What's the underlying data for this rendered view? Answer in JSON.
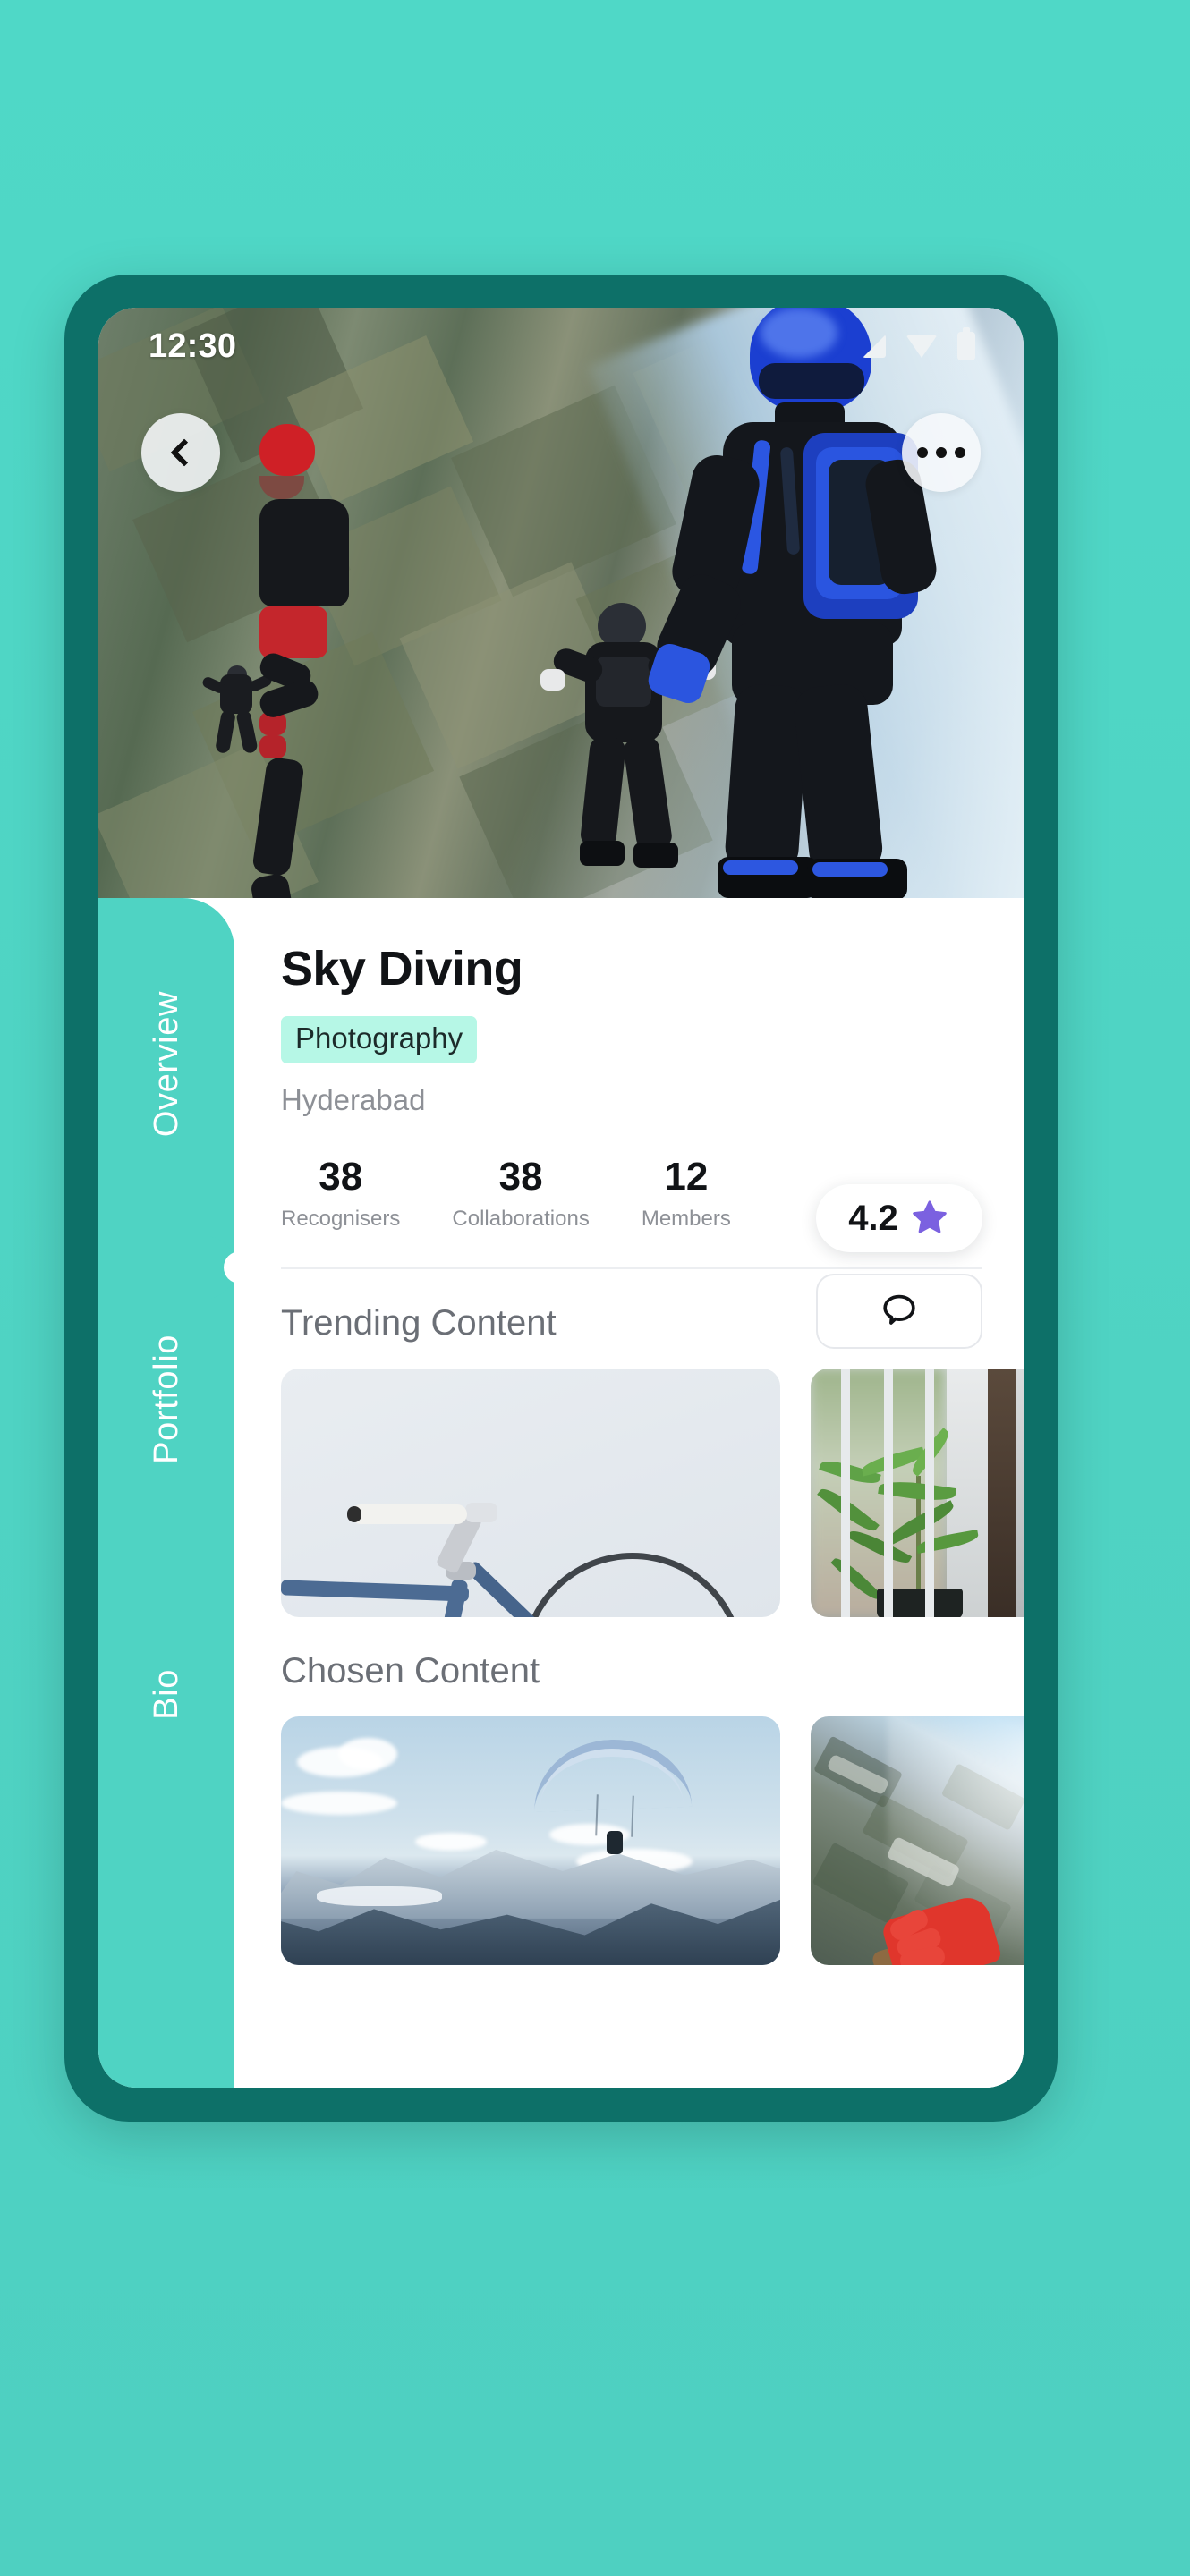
{
  "theme": {
    "page_background": "#4fd3c3",
    "device_bezel": "#0d7068",
    "rail_background": "#4fd3c3",
    "tag_background": "#b6f7e6",
    "star_color": "#7b61e0",
    "accent": "#4fd3c3"
  },
  "status_bar": {
    "time": "12:30",
    "icons": [
      "signal-icon",
      "wifi-icon",
      "battery-icon"
    ]
  },
  "hero": {
    "image_alt": "Skydivers in freefall above patchwork farmland",
    "back_icon": "chevron-left-icon",
    "more_icon": "more-horizontal-icon"
  },
  "side_rail": {
    "tabs": [
      {
        "label": "Overview",
        "active": true
      },
      {
        "label": "Portfolio",
        "active": false
      },
      {
        "label": "Bio",
        "active": false
      }
    ]
  },
  "profile": {
    "title": "Sky Diving",
    "category": "Photography",
    "location": "Hyderabad",
    "stats": [
      {
        "value": "38",
        "label": "Recognisers"
      },
      {
        "value": "38",
        "label": "Collaborations"
      },
      {
        "value": "12",
        "label": "Members"
      }
    ],
    "rating": {
      "value": "4.2",
      "icon": "star-icon"
    },
    "chat": {
      "icon": "chat-bubble-icon"
    }
  },
  "sections": [
    {
      "title": "Trending Content",
      "items": [
        {
          "alt": "White-handlebar blue road bicycle on light grey backdrop"
        },
        {
          "alt": "Green potted plants beside a barred window"
        }
      ]
    },
    {
      "title": "Chosen Content",
      "items": [
        {
          "alt": "Paraglider soaring above snow-capped mountain range"
        },
        {
          "alt": "Aerial skydiving view with red glove over landscape"
        }
      ]
    }
  ]
}
